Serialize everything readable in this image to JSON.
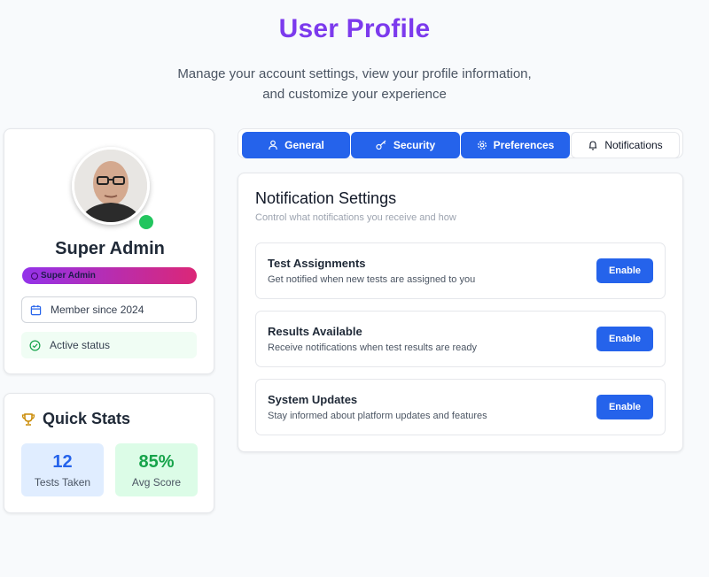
{
  "header": {
    "title": "User Profile",
    "subtitle": "Manage your account settings, view your profile information, and customize your experience"
  },
  "profile": {
    "name": "Super Admin",
    "role_badge": "Super Admin",
    "member_since": "Member since 2024",
    "status": "Active status",
    "online_indicator_color": "#22c55e"
  },
  "quick_stats": {
    "title": "Quick Stats",
    "tests_taken_value": "12",
    "tests_taken_label": "Tests Taken",
    "avg_score_value": "85%",
    "avg_score_label": "Avg Score"
  },
  "tabs": [
    {
      "label": "General",
      "icon": "user-icon",
      "active": true
    },
    {
      "label": "Security",
      "icon": "key-icon",
      "active": true
    },
    {
      "label": "Preferences",
      "icon": "gear-icon",
      "active": true
    },
    {
      "label": "Notifications",
      "icon": "bell-icon",
      "active": false
    }
  ],
  "notifications": {
    "title": "Notification Settings",
    "subtitle": "Control what notifications you receive and how",
    "items": [
      {
        "title": "Test Assignments",
        "description": "Get notified when new tests are assigned to you",
        "button": "Enable"
      },
      {
        "title": "Results Available",
        "description": "Receive notifications when test results are ready",
        "button": "Enable"
      },
      {
        "title": "System Updates",
        "description": "Stay informed about platform updates and features",
        "button": "Enable"
      }
    ]
  },
  "colors": {
    "accent": "#2563eb",
    "title": "#7c3aed",
    "success": "#16a34a",
    "badge_gradient_start": "#9333ea",
    "badge_gradient_end": "#db2777"
  }
}
